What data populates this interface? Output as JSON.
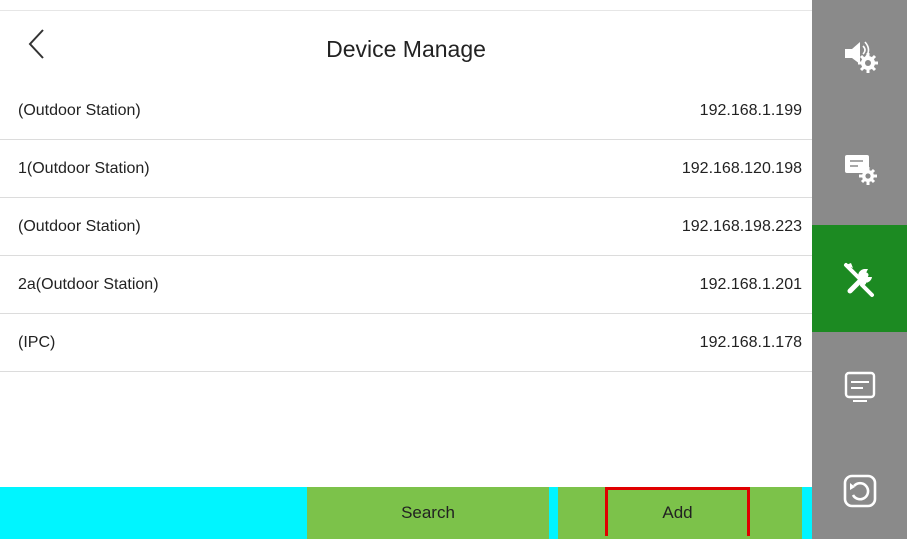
{
  "header": {
    "title": "Device Manage"
  },
  "devices": [
    {
      "name": "(Outdoor Station)",
      "ip": "192.168.1.199"
    },
    {
      "name": "1(Outdoor Station)",
      "ip": "192.168.120.198"
    },
    {
      "name": "(Outdoor Station)",
      "ip": "192.168.198.223"
    },
    {
      "name": "2a(Outdoor Station)",
      "ip": "192.168.1.201"
    },
    {
      "name": "(IPC)",
      "ip": "192.168.1.178"
    }
  ],
  "toolbar": {
    "search_label": "Search",
    "add_label": "Add"
  },
  "sidebar": {
    "items": [
      {
        "icon": "speaker-settings-icon",
        "active": false
      },
      {
        "icon": "display-settings-icon",
        "active": false
      },
      {
        "icon": "tools-icon",
        "active": true
      },
      {
        "icon": "message-icon",
        "active": false
      },
      {
        "icon": "restore-icon",
        "active": false
      }
    ]
  },
  "colors": {
    "toolbar_cyan": "#00f5ff",
    "toolbar_green": "#7cc24a",
    "sidebar_gray": "#8a8a8a",
    "sidebar_active": "#1c8a22",
    "highlight_red": "#e00000"
  }
}
